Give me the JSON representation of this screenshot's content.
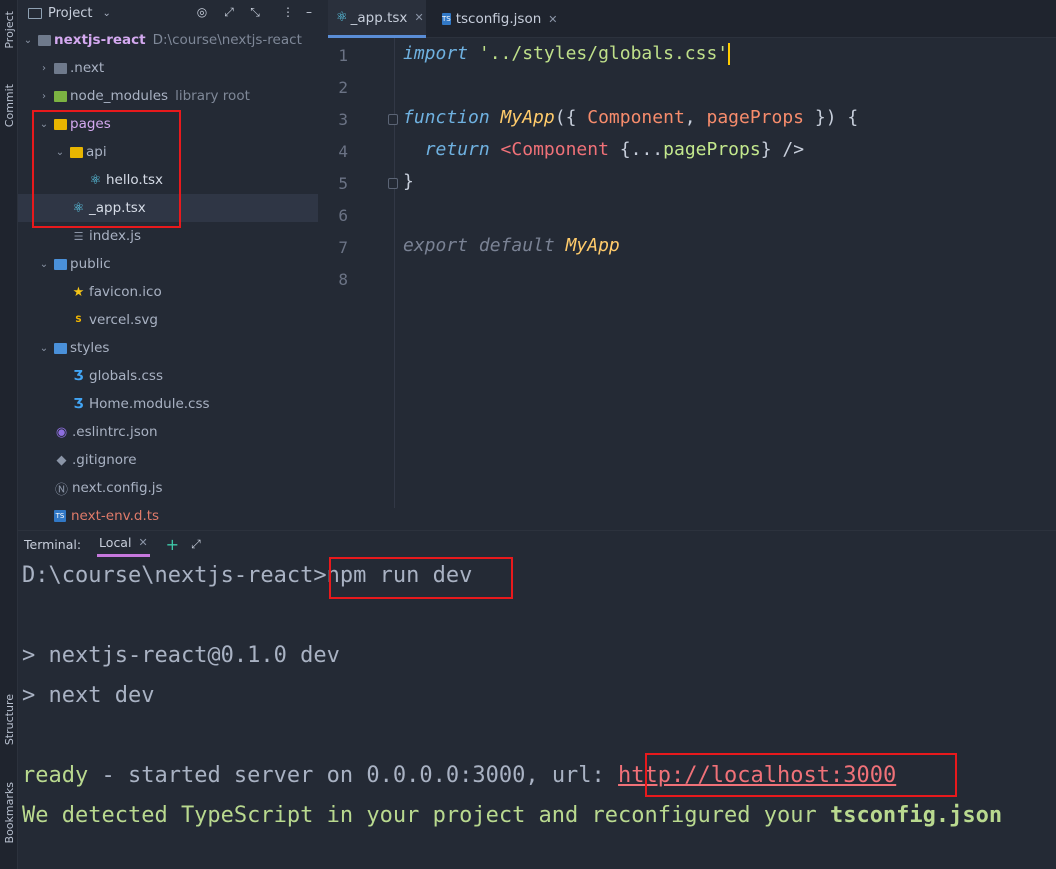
{
  "toolstrip": {
    "project": "Project",
    "commit": "Commit",
    "structure": "Structure",
    "bookmarks": "Bookmarks"
  },
  "project_panel": {
    "title": "Project",
    "tree": [
      {
        "label": "nextjs-react",
        "extra": "D:\\course\\nextjs-react",
        "depth": 0,
        "expanded": true,
        "icon": "folder-icon"
      },
      {
        "label": ".next",
        "depth": 1,
        "expanded": false,
        "icon": "folder-icon"
      },
      {
        "label": "node_modules",
        "extra": "library root",
        "depth": 1,
        "expanded": false,
        "icon": "folder-icon"
      },
      {
        "label": "pages",
        "depth": 1,
        "expanded": true,
        "icon": "folder-icon"
      },
      {
        "label": "api",
        "depth": 2,
        "expanded": true,
        "icon": "folder-icon"
      },
      {
        "label": "hello.tsx",
        "depth": 3,
        "icon": "react-icon"
      },
      {
        "label": "_app.tsx",
        "depth": 2,
        "icon": "react-icon"
      },
      {
        "label": "index.js",
        "depth": 2,
        "icon": "js-file-icon"
      },
      {
        "label": "public",
        "depth": 1,
        "expanded": true,
        "icon": "folder-icon"
      },
      {
        "label": "favicon.ico",
        "depth": 2,
        "icon": "star-icon"
      },
      {
        "label": "vercel.svg",
        "depth": 2,
        "icon": "svg-file-icon"
      },
      {
        "label": "styles",
        "depth": 1,
        "expanded": true,
        "icon": "folder-icon"
      },
      {
        "label": "globals.css",
        "depth": 2,
        "icon": "css-file-icon"
      },
      {
        "label": "Home.module.css",
        "depth": 2,
        "icon": "css-file-icon"
      },
      {
        "label": ".eslintrc.json",
        "depth": 1,
        "icon": "eslint-icon"
      },
      {
        "label": ".gitignore",
        "depth": 1,
        "icon": "git-icon"
      },
      {
        "label": "next.config.js",
        "depth": 1,
        "icon": "next-icon"
      },
      {
        "label": "next-env.d.ts",
        "depth": 1,
        "icon": "ts-file-icon"
      }
    ]
  },
  "editor": {
    "tabs": [
      {
        "label": "_app.tsx",
        "active": true
      },
      {
        "label": "tsconfig.json",
        "active": false
      }
    ],
    "line_numbers": [
      "1",
      "2",
      "3",
      "4",
      "5",
      "6",
      "7",
      "8"
    ],
    "code": {
      "l1_kw": "import",
      "l1_str": "'../styles/globals.css'",
      "l3_kw": "function",
      "l3_fn": "MyApp",
      "l3_open": "({ ",
      "l3_p1": "Component",
      "l3_comma": ", ",
      "l3_p2": "pageProps",
      "l3_close": " }) {",
      "l4_kw": "return",
      "l4_lt": " <",
      "l4_tag": "Component",
      "l4_open": " {...",
      "l4_prop": "pageProps",
      "l4_close": "} />",
      "l5": "}",
      "l7_kw": "export default",
      "l7_fn": "MyApp"
    }
  },
  "terminal": {
    "label": "Terminal:",
    "tab": "Local",
    "prompt": "D:\\course\\nextjs-react>",
    "command": "npm run dev",
    "out1": "> nextjs-react@0.1.0 dev",
    "out2": "> next dev",
    "ready_word": "ready",
    "ready_text": " - started server on 0.0.0.0:3000, url: ",
    "url": "http://localhost:3000",
    "ts_text": "We detected TypeScript in your project and reconfigured your ",
    "ts_file": "tsconfig.json"
  },
  "colors": {
    "highlight": "#e8191c",
    "accent_tab": "#5a8dd6",
    "terminal_tab": "#c678dd"
  }
}
